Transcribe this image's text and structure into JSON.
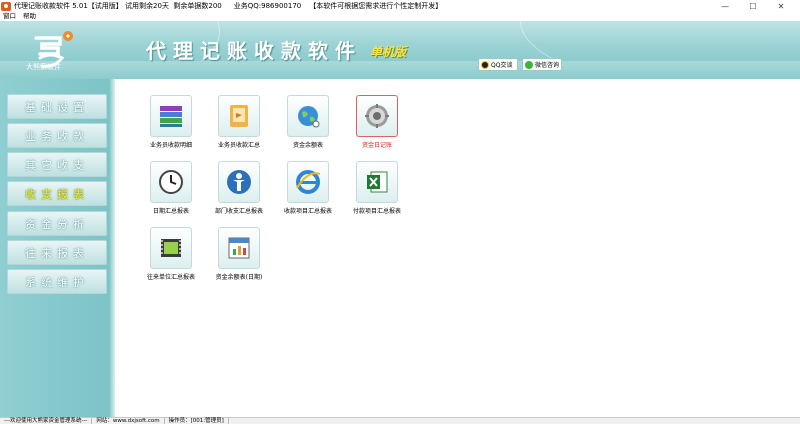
{
  "titlebar": {
    "title": "代理记账收款软件 5.01【试用版】 试用剩余20天  剩余单据数200",
    "contact": "业务QQ:986900170",
    "note": "【本软件可根据您需求进行个性定制开发】",
    "min_glyph": "—",
    "max_glyph": "☐",
    "close_glyph": "✕"
  },
  "menu": {
    "items": [
      "窗口",
      "帮助"
    ]
  },
  "header": {
    "logo_text": "大熊家软件",
    "title": "代理记账收款软件",
    "subtitle": "单机版",
    "qq_button": "QQ交谈",
    "wechat_button": "微信咨询"
  },
  "sidebar": {
    "items": [
      "基础设置",
      "业务收款",
      "其它收支",
      "收支报表",
      "资金分析",
      "往来报表",
      "系统维护"
    ],
    "active_index": 3
  },
  "tiles": [
    {
      "label": "业务员收款明细",
      "icon": "books-icon"
    },
    {
      "label": "业务员收款汇总",
      "icon": "folder-icon"
    },
    {
      "label": "资金余额表",
      "icon": "globe-icon"
    },
    {
      "label": "资金日记账",
      "icon": "gear-icon",
      "selected": true
    },
    {
      "label": "日期汇总报表",
      "icon": "clock-icon"
    },
    {
      "label": "部门收支汇总报表",
      "icon": "person-icon"
    },
    {
      "label": "收款项目汇总报表",
      "icon": "ie-browser-icon"
    },
    {
      "label": "付款项目汇总报表",
      "icon": "excel-icon"
    },
    {
      "label": "往来单位汇总报表",
      "icon": "film-icon"
    },
    {
      "label": "资金余额表(日期)",
      "icon": "calendar-chart-icon"
    }
  ],
  "status": {
    "welcome": "---欢迎使用大熊家资金管理系统---",
    "website": "网站：www.dxjsoft.com",
    "operator": "操作员：[001:管理员]"
  }
}
